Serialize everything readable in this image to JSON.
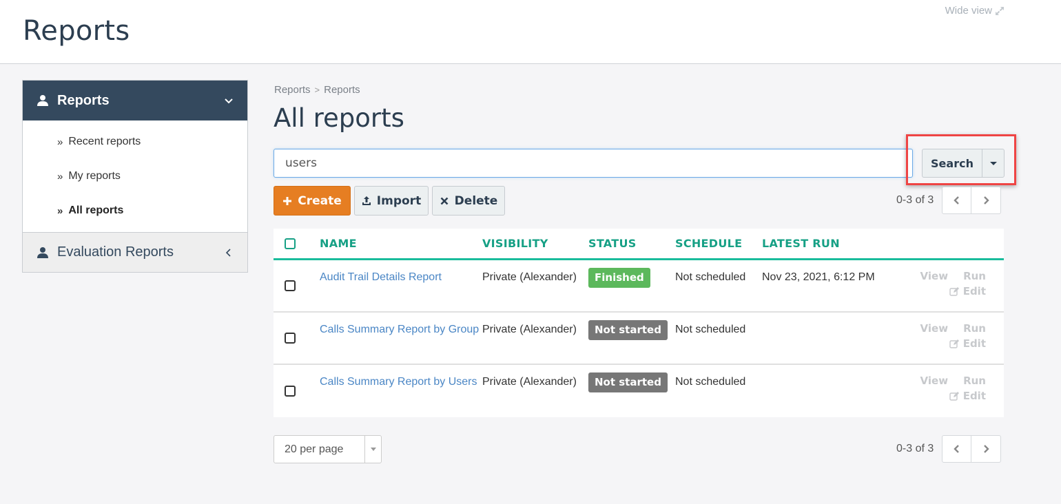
{
  "app": {
    "title": "Reports",
    "wide_view_label": "Wide view"
  },
  "sidebar": {
    "sections": [
      {
        "label": "Reports",
        "expanded": true,
        "items": [
          {
            "label": "Recent reports",
            "active": false
          },
          {
            "label": "My reports",
            "active": false
          },
          {
            "label": "All reports",
            "active": true
          }
        ]
      },
      {
        "label": "Evaluation Reports",
        "expanded": false
      }
    ]
  },
  "breadcrumb": [
    "Reports",
    "Reports"
  ],
  "page_title": "All reports",
  "search": {
    "value": "users",
    "button_label": "Search"
  },
  "toolbar": {
    "create_label": "Create",
    "import_label": "Import",
    "delete_label": "Delete"
  },
  "pagination": {
    "count_text": "0-3 of 3",
    "per_page": "20 per page"
  },
  "table": {
    "columns": [
      "NAME",
      "VISIBILITY",
      "STATUS",
      "SCHEDULE",
      "LATEST RUN"
    ],
    "rows": [
      {
        "name": "Audit Trail Details Report",
        "visibility": "Private (Alexander)",
        "status": "Finished",
        "schedule": "Not scheduled",
        "latest_run": "Nov 23, 2021, 6:12 PM",
        "actions": {
          "view": "View",
          "run": "Run",
          "edit": "Edit"
        }
      },
      {
        "name": "Calls Summary Report by Group",
        "visibility": "Private (Alexander)",
        "status": "Not started",
        "schedule": "Not scheduled",
        "latest_run": "",
        "actions": {
          "view": "View",
          "run": "Run",
          "edit": "Edit"
        }
      },
      {
        "name": "Calls Summary Report by Users",
        "visibility": "Private (Alexander)",
        "status": "Not started",
        "schedule": "Not scheduled",
        "latest_run": "",
        "actions": {
          "view": "View",
          "run": "Run",
          "edit": "Edit"
        }
      }
    ]
  },
  "colors": {
    "sidebar_header": "#34495e",
    "accent_teal": "#16a085",
    "create_orange": "#e67e22",
    "status_finished": "#5cb85c",
    "status_not_started": "#777777",
    "link_blue": "#4a86c5",
    "highlight_red": "#ef4444"
  }
}
